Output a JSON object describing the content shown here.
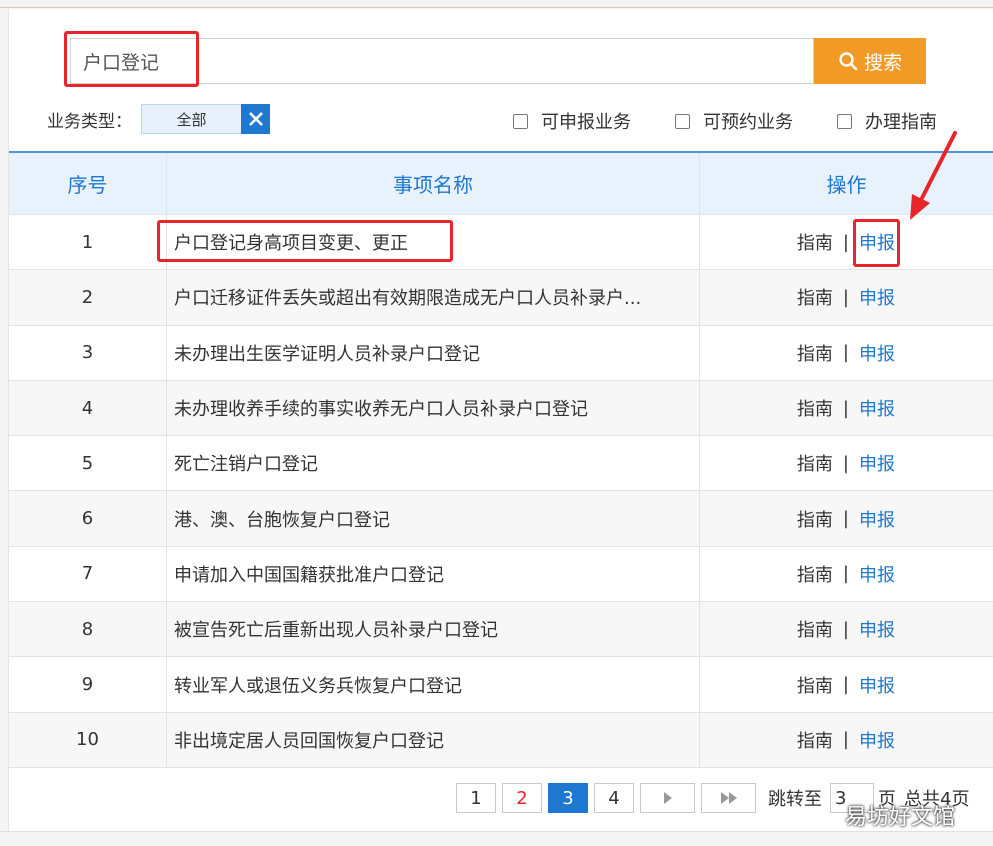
{
  "search": {
    "value": "户口登记",
    "button_label": "搜索"
  },
  "filters": {
    "type_label": "业务类型：",
    "type_value": "全部",
    "checkboxes": [
      "可申报业务",
      "可预约业务",
      "办理指南"
    ]
  },
  "table": {
    "headers": [
      "序号",
      "事项名称",
      "操作"
    ],
    "guide_label": "指南",
    "separator": "|",
    "apply_label": "申报",
    "rows": [
      {
        "no": "1",
        "name": "户口登记身高项目变更、更正"
      },
      {
        "no": "2",
        "name": "户口迁移证件丢失或超出有效期限造成无户口人员补录户..."
      },
      {
        "no": "3",
        "name": "未办理出生医学证明人员补录户口登记"
      },
      {
        "no": "4",
        "name": "未办理收养手续的事实收养无户口人员补录户口登记"
      },
      {
        "no": "5",
        "name": "死亡注销户口登记"
      },
      {
        "no": "6",
        "name": "港、澳、台胞恢复户口登记"
      },
      {
        "no": "7",
        "name": "申请加入中国国籍获批准户口登记"
      },
      {
        "no": "8",
        "name": "被宣告死亡后重新出现人员补录户口登记"
      },
      {
        "no": "9",
        "name": "转业军人或退伍义务兵恢复户口登记"
      },
      {
        "no": "10",
        "name": "非出境定居人员回国恢复户口登记"
      }
    ]
  },
  "pagination": {
    "pages": [
      "1",
      "2",
      "3",
      "4"
    ],
    "current": "3",
    "jump_label": "跳转至",
    "jump_value": "3",
    "page_unit": "页",
    "total_text": "总共4页"
  },
  "watermark": "易坊好文馆",
  "colors": {
    "accent_blue": "#1e78d0",
    "search_orange": "#f19a26",
    "highlight_red": "#e8262a"
  }
}
